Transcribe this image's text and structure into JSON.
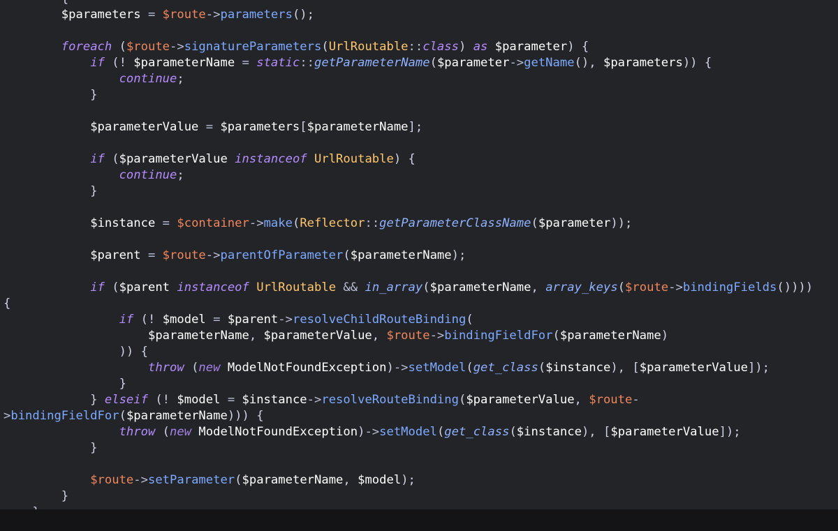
{
  "editor": {
    "lines": [
      [
        {
          "t": "        {",
          "c": "punc"
        }
      ],
      [
        {
          "t": "        ",
          "c": "var"
        },
        {
          "t": "$parameters",
          "c": "var"
        },
        {
          "t": " = ",
          "c": "op"
        },
        {
          "t": "$route",
          "c": "route"
        },
        {
          "t": "->",
          "c": "op"
        },
        {
          "t": "parameters",
          "c": "method"
        },
        {
          "t": "();",
          "c": "punc"
        }
      ],
      [],
      [
        {
          "t": "        ",
          "c": "var"
        },
        {
          "t": "foreach",
          "c": "kw"
        },
        {
          "t": " (",
          "c": "punc"
        },
        {
          "t": "$route",
          "c": "route"
        },
        {
          "t": "->",
          "c": "op"
        },
        {
          "t": "signatureParameters",
          "c": "method"
        },
        {
          "t": "(",
          "c": "punc"
        },
        {
          "t": "UrlRoutable",
          "c": "class"
        },
        {
          "t": "::",
          "c": "op"
        },
        {
          "t": "class",
          "c": "kw"
        },
        {
          "t": ") ",
          "c": "punc"
        },
        {
          "t": "as",
          "c": "kw"
        },
        {
          "t": " $parameter",
          "c": "var"
        },
        {
          "t": ") {",
          "c": "punc"
        }
      ],
      [
        {
          "t": "            ",
          "c": "var"
        },
        {
          "t": "if",
          "c": "kw"
        },
        {
          "t": " (! ",
          "c": "punc"
        },
        {
          "t": "$parameterName",
          "c": "var"
        },
        {
          "t": " = ",
          "c": "op"
        },
        {
          "t": "static",
          "c": "static"
        },
        {
          "t": "::",
          "c": "op"
        },
        {
          "t": "getParameterName",
          "c": "fn"
        },
        {
          "t": "(",
          "c": "punc"
        },
        {
          "t": "$parameter",
          "c": "var"
        },
        {
          "t": "->",
          "c": "op"
        },
        {
          "t": "getName",
          "c": "method"
        },
        {
          "t": "(), ",
          "c": "punc"
        },
        {
          "t": "$parameters",
          "c": "var"
        },
        {
          "t": ")) {",
          "c": "punc"
        }
      ],
      [
        {
          "t": "                ",
          "c": "var"
        },
        {
          "t": "continue",
          "c": "kw"
        },
        {
          "t": ";",
          "c": "punc"
        }
      ],
      [
        {
          "t": "            }",
          "c": "punc"
        }
      ],
      [],
      [
        {
          "t": "            ",
          "c": "var"
        },
        {
          "t": "$parameterValue",
          "c": "var"
        },
        {
          "t": " = ",
          "c": "op"
        },
        {
          "t": "$parameters",
          "c": "var"
        },
        {
          "t": "[",
          "c": "punc"
        },
        {
          "t": "$parameterName",
          "c": "var"
        },
        {
          "t": "];",
          "c": "punc"
        }
      ],
      [],
      [
        {
          "t": "            ",
          "c": "var"
        },
        {
          "t": "if",
          "c": "kw"
        },
        {
          "t": " (",
          "c": "punc"
        },
        {
          "t": "$parameterValue",
          "c": "var"
        },
        {
          "t": " ",
          "c": "var"
        },
        {
          "t": "instanceof",
          "c": "kw"
        },
        {
          "t": " ",
          "c": "var"
        },
        {
          "t": "UrlRoutable",
          "c": "class"
        },
        {
          "t": ") {",
          "c": "punc"
        }
      ],
      [
        {
          "t": "                ",
          "c": "var"
        },
        {
          "t": "continue",
          "c": "kw"
        },
        {
          "t": ";",
          "c": "punc"
        }
      ],
      [
        {
          "t": "            }",
          "c": "punc"
        }
      ],
      [],
      [
        {
          "t": "            ",
          "c": "var"
        },
        {
          "t": "$instance",
          "c": "var"
        },
        {
          "t": " = ",
          "c": "op"
        },
        {
          "t": "$container",
          "c": "route"
        },
        {
          "t": "->",
          "c": "op"
        },
        {
          "t": "make",
          "c": "method"
        },
        {
          "t": "(",
          "c": "punc"
        },
        {
          "t": "Reflector",
          "c": "class"
        },
        {
          "t": "::",
          "c": "op"
        },
        {
          "t": "getParameterClassName",
          "c": "fn"
        },
        {
          "t": "(",
          "c": "punc"
        },
        {
          "t": "$parameter",
          "c": "var"
        },
        {
          "t": "));",
          "c": "punc"
        }
      ],
      [],
      [
        {
          "t": "            ",
          "c": "var"
        },
        {
          "t": "$parent",
          "c": "var"
        },
        {
          "t": " = ",
          "c": "op"
        },
        {
          "t": "$route",
          "c": "route"
        },
        {
          "t": "->",
          "c": "op"
        },
        {
          "t": "parentOfParameter",
          "c": "method"
        },
        {
          "t": "(",
          "c": "punc"
        },
        {
          "t": "$parameterName",
          "c": "var"
        },
        {
          "t": ");",
          "c": "punc"
        }
      ],
      [],
      [
        {
          "t": "            ",
          "c": "var"
        },
        {
          "t": "if",
          "c": "kw"
        },
        {
          "t": " (",
          "c": "punc"
        },
        {
          "t": "$parent",
          "c": "var"
        },
        {
          "t": " ",
          "c": "var"
        },
        {
          "t": "instanceof",
          "c": "kw"
        },
        {
          "t": " ",
          "c": "var"
        },
        {
          "t": "UrlRoutable",
          "c": "class"
        },
        {
          "t": " && ",
          "c": "op"
        },
        {
          "t": "in_array",
          "c": "fn"
        },
        {
          "t": "(",
          "c": "punc"
        },
        {
          "t": "$parameterName",
          "c": "var"
        },
        {
          "t": ", ",
          "c": "punc"
        },
        {
          "t": "array_keys",
          "c": "fn"
        },
        {
          "t": "(",
          "c": "punc"
        },
        {
          "t": "$route",
          "c": "route"
        },
        {
          "t": "->",
          "c": "op"
        },
        {
          "t": "bindingFields",
          "c": "method"
        },
        {
          "t": "()))) ",
          "c": "punc"
        }
      ],
      [
        {
          "t": "{",
          "c": "punc"
        }
      ],
      [
        {
          "t": "                ",
          "c": "var"
        },
        {
          "t": "if",
          "c": "kw"
        },
        {
          "t": " (! ",
          "c": "punc"
        },
        {
          "t": "$model",
          "c": "var"
        },
        {
          "t": " = ",
          "c": "op"
        },
        {
          "t": "$parent",
          "c": "var"
        },
        {
          "t": "->",
          "c": "op"
        },
        {
          "t": "resolveChildRouteBinding",
          "c": "method"
        },
        {
          "t": "(",
          "c": "punc"
        }
      ],
      [
        {
          "t": "                    ",
          "c": "var"
        },
        {
          "t": "$parameterName",
          "c": "var"
        },
        {
          "t": ", ",
          "c": "punc"
        },
        {
          "t": "$parameterValue",
          "c": "var"
        },
        {
          "t": ", ",
          "c": "punc"
        },
        {
          "t": "$route",
          "c": "route"
        },
        {
          "t": "->",
          "c": "op"
        },
        {
          "t": "bindingFieldFor",
          "c": "method"
        },
        {
          "t": "(",
          "c": "punc"
        },
        {
          "t": "$parameterName",
          "c": "var"
        },
        {
          "t": ")",
          "c": "punc"
        }
      ],
      [
        {
          "t": "                )) {",
          "c": "punc"
        }
      ],
      [
        {
          "t": "                    ",
          "c": "var"
        },
        {
          "t": "throw",
          "c": "kw"
        },
        {
          "t": " (",
          "c": "punc"
        },
        {
          "t": "new",
          "c": "kw2"
        },
        {
          "t": " ModelNotFoundException",
          "c": "var"
        },
        {
          "t": ")",
          "c": "punc"
        },
        {
          "t": "->",
          "c": "op"
        },
        {
          "t": "setModel",
          "c": "method"
        },
        {
          "t": "(",
          "c": "punc"
        },
        {
          "t": "get_class",
          "c": "fn"
        },
        {
          "t": "(",
          "c": "punc"
        },
        {
          "t": "$instance",
          "c": "var"
        },
        {
          "t": "), [",
          "c": "punc"
        },
        {
          "t": "$parameterValue",
          "c": "var"
        },
        {
          "t": "]);",
          "c": "punc"
        }
      ],
      [
        {
          "t": "                }",
          "c": "punc"
        }
      ],
      [
        {
          "t": "            } ",
          "c": "punc"
        },
        {
          "t": "elseif",
          "c": "kw"
        },
        {
          "t": " (! ",
          "c": "punc"
        },
        {
          "t": "$model",
          "c": "var"
        },
        {
          "t": " = ",
          "c": "op"
        },
        {
          "t": "$instance",
          "c": "var"
        },
        {
          "t": "->",
          "c": "op"
        },
        {
          "t": "resolveRouteBinding",
          "c": "method"
        },
        {
          "t": "(",
          "c": "punc"
        },
        {
          "t": "$parameterValue",
          "c": "var"
        },
        {
          "t": ", ",
          "c": "punc"
        },
        {
          "t": "$route",
          "c": "route"
        },
        {
          "t": "-",
          "c": "op"
        }
      ],
      [
        {
          "t": ">",
          "c": "op"
        },
        {
          "t": "bindingFieldFor",
          "c": "method"
        },
        {
          "t": "(",
          "c": "punc"
        },
        {
          "t": "$parameterName",
          "c": "var"
        },
        {
          "t": "))) {",
          "c": "punc"
        }
      ],
      [
        {
          "t": "                ",
          "c": "var"
        },
        {
          "t": "throw",
          "c": "kw"
        },
        {
          "t": " (",
          "c": "punc"
        },
        {
          "t": "new",
          "c": "kw2"
        },
        {
          "t": " ModelNotFoundException",
          "c": "var"
        },
        {
          "t": ")",
          "c": "punc"
        },
        {
          "t": "->",
          "c": "op"
        },
        {
          "t": "setModel",
          "c": "method"
        },
        {
          "t": "(",
          "c": "punc"
        },
        {
          "t": "get_class",
          "c": "fn"
        },
        {
          "t": "(",
          "c": "punc"
        },
        {
          "t": "$instance",
          "c": "var"
        },
        {
          "t": "), [",
          "c": "punc"
        },
        {
          "t": "$parameterValue",
          "c": "var"
        },
        {
          "t": "]);",
          "c": "punc"
        }
      ],
      [
        {
          "t": "            }",
          "c": "punc"
        }
      ],
      [],
      [
        {
          "t": "            ",
          "c": "var"
        },
        {
          "t": "$route",
          "c": "route"
        },
        {
          "t": "->",
          "c": "op"
        },
        {
          "t": "setParameter",
          "c": "method"
        },
        {
          "t": "(",
          "c": "punc"
        },
        {
          "t": "$parameterName",
          "c": "var"
        },
        {
          "t": ", ",
          "c": "punc"
        },
        {
          "t": "$model",
          "c": "var"
        },
        {
          "t": ");",
          "c": "punc"
        }
      ],
      [
        {
          "t": "        }",
          "c": "punc"
        }
      ],
      [
        {
          "t": "    }",
          "c": "punc"
        }
      ]
    ]
  }
}
